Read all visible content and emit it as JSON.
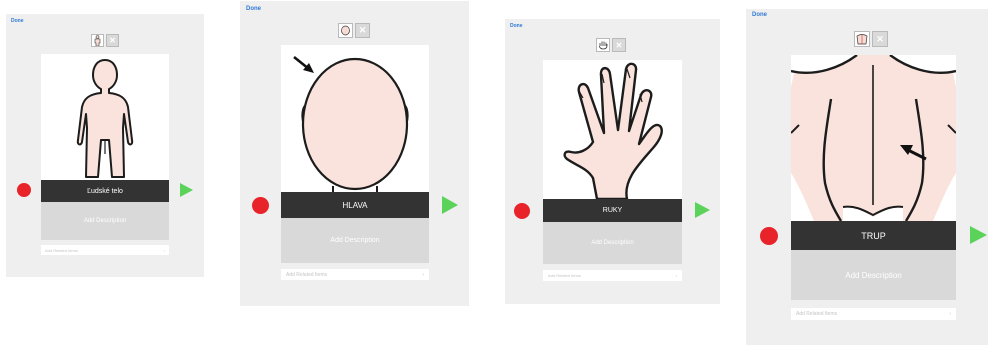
{
  "screens": [
    {
      "done_label": "Done",
      "item_name": "Ľudské telo",
      "description_placeholder": "Add Description",
      "related_placeholder": "Add Related Items",
      "related_chevron": "›",
      "thumb_icon": "body-icon",
      "close_icon": "close-icon",
      "record_icon": "record-icon",
      "play_icon": "play-icon"
    },
    {
      "done_label": "Done",
      "item_name": "HLAVA",
      "description_placeholder": "Add Description",
      "related_placeholder": "Add Related Items",
      "related_chevron": "›",
      "thumb_icon": "head-icon",
      "close_icon": "close-icon",
      "record_icon": "record-icon",
      "play_icon": "play-icon"
    },
    {
      "done_label": "Done",
      "item_name": "RUKY",
      "description_placeholder": "Add Description",
      "related_placeholder": "Add Related Items",
      "related_chevron": "›",
      "thumb_icon": "hand-icon",
      "close_icon": "close-icon",
      "record_icon": "record-icon",
      "play_icon": "play-icon"
    },
    {
      "done_label": "Done",
      "item_name": "TRUP",
      "description_placeholder": "Add Description",
      "related_placeholder": "Add Related Items",
      "related_chevron": "›",
      "thumb_icon": "torso-icon",
      "close_icon": "close-icon",
      "record_icon": "record-icon",
      "play_icon": "play-icon"
    }
  ],
  "colors": {
    "accent": "#2f7ad6",
    "record": "#e8232a",
    "play": "#5bd35b",
    "name_bar": "#333333",
    "skin": "#f9e3dc"
  }
}
